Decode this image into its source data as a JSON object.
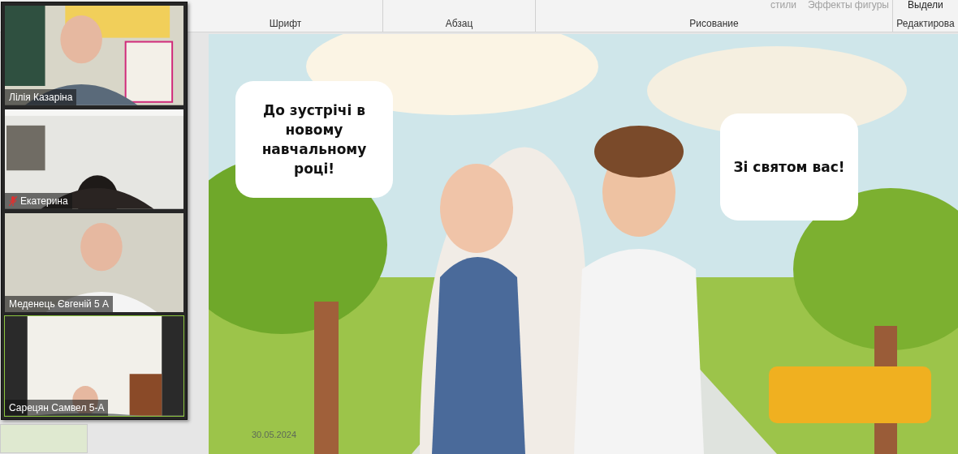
{
  "ribbon": {
    "groups": [
      {
        "label": "Шрифт"
      },
      {
        "label": "Абзац"
      },
      {
        "label": "Рисование",
        "controls": [
          "стили",
          "Эффекты фигуры"
        ]
      },
      {
        "label": "Редактирова",
        "controls": [
          "Выдели"
        ]
      }
    ]
  },
  "slide": {
    "bubbles": [
      {
        "text": "До зустрічі в новому навчальному році!"
      },
      {
        "text": "Зі святом вас!"
      }
    ],
    "date": "30.05.2024"
  },
  "video_panel": {
    "tiles": [
      {
        "name": "Лілія Казаріна",
        "muted": false,
        "highlighted": false
      },
      {
        "name": "Екатерина",
        "muted": true,
        "highlighted": false
      },
      {
        "name": "Меденець Євгеній 5 А",
        "muted": false,
        "highlighted": false
      },
      {
        "name": "Сарецян Самвел 5-А",
        "muted": false,
        "highlighted": true
      }
    ]
  }
}
